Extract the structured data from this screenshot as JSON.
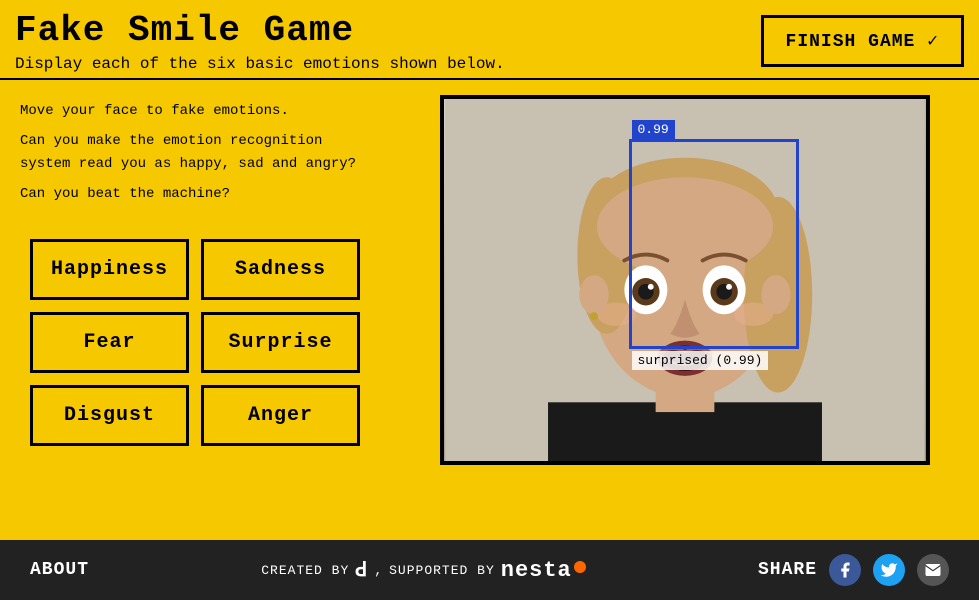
{
  "header": {
    "title": "Fake Smile Game",
    "subtitle": "Display each of the six basic emotions shown below.",
    "finish_btn": "FINISH GAME  ✓"
  },
  "instructions": {
    "line1": "Move your face to fake emotions.",
    "line2": "Can you make the emotion recognition system read you as happy, sad and angry?",
    "line3": "Can you beat the machine?"
  },
  "emotions": [
    {
      "id": "happiness",
      "label": "Happiness"
    },
    {
      "id": "sadness",
      "label": "Sadness"
    },
    {
      "id": "fear",
      "label": "Fear"
    },
    {
      "id": "surprise",
      "label": "Surprise"
    },
    {
      "id": "disgust",
      "label": "Disgust"
    },
    {
      "id": "anger",
      "label": "Anger"
    }
  ],
  "camera": {
    "confidence": "0.99",
    "detected_emotion": "surprised (0.99)"
  },
  "footer": {
    "about": "ABOUT",
    "created_by": "CREATED BY",
    "supported_by": "SUPPORTED BY",
    "nesta": "nesta",
    "share": "SHARE"
  },
  "colors": {
    "yellow": "#F5C800",
    "dark": "#222222",
    "blue": "#2244cc"
  }
}
